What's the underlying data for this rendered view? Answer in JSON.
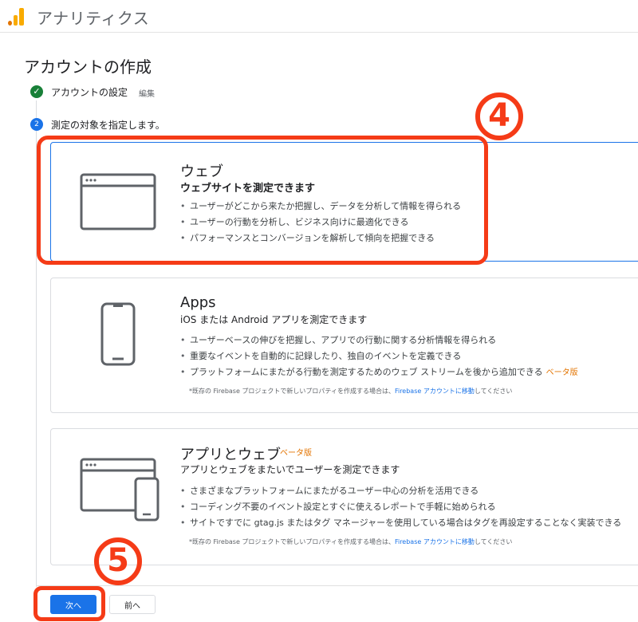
{
  "app": {
    "title": "アナリティクス"
  },
  "page": {
    "title": "アカウントの作成"
  },
  "steps": [
    {
      "number": "✓",
      "label": "アカウントの設定",
      "action": "編集"
    },
    {
      "number": "2",
      "label": "測定の対象を指定します。"
    }
  ],
  "cards": {
    "web": {
      "title": "ウェブ",
      "subtitle": "ウェブサイトを測定できます",
      "bullets": [
        "ユーザーがどこから来たか把握し、データを分析して情報を得られる",
        "ユーザーの行動を分析し、ビジネス向けに最適化できる",
        "パフォーマンスとコンバージョンを解析して傾向を把握できる"
      ]
    },
    "apps": {
      "title": "Apps",
      "subtitle": "iOS または Android アプリを測定できます",
      "bullets": [
        "ユーザーベースの伸びを把握し、アプリでの行動に関する分析情報を得られる",
        "重要なイベントを自動的に記録したり、独自のイベントを定義できる",
        "プラットフォームにまたがる行動を測定するためのウェブ ストリームを後から追加できる"
      ],
      "bullet3_beta": "ベータ版",
      "note_prefix": "*既存の Firebase プロジェクトで新しいプロパティを作成する場合は、",
      "note_link": "Firebase アカウントに移動",
      "note_suffix": "してください"
    },
    "appweb": {
      "title": "アプリとウェブ",
      "title_beta": "ベータ版",
      "subtitle": "アプリとウェブをまたいでユーザーを測定できます",
      "bullets": [
        "さまざまなプラットフォームにまたがるユーザー中心の分析を活用できる",
        "コーディング不要のイベント設定とすぐに使えるレポートで手軽に始められる",
        "サイトですでに gtag.js またはタグ マネージャーを使用している場合はタグを再設定することなく実装できる"
      ],
      "note_prefix": "*既存の Firebase プロジェクトで新しいプロパティを作成する場合は、",
      "note_link": "Firebase アカウントに移動",
      "note_suffix": "してください"
    }
  },
  "buttons": {
    "next": "次へ",
    "prev": "前へ"
  },
  "annotations": {
    "marker4": "4",
    "marker5": "5"
  },
  "colors": {
    "accent": "#1a73e8",
    "highlight": "#f53b17",
    "success": "#188038",
    "beta": "#e37400"
  }
}
